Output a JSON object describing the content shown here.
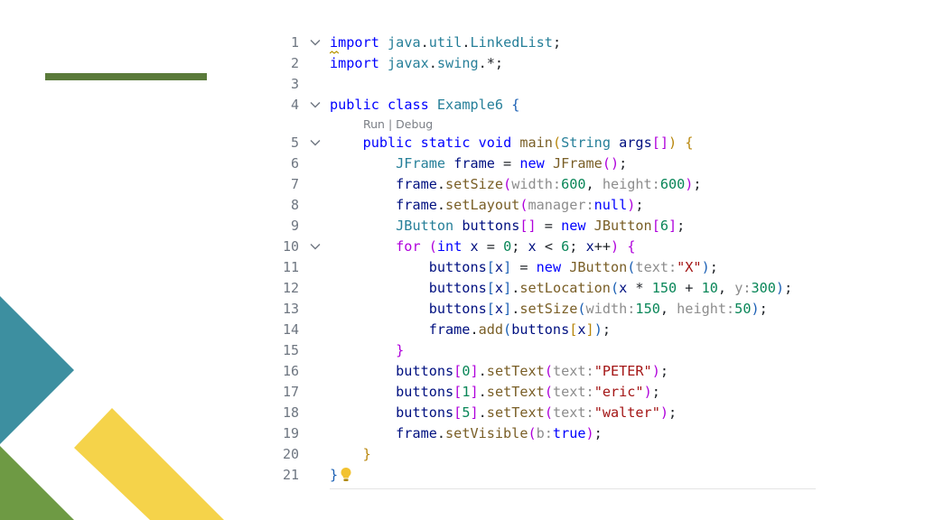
{
  "editor": {
    "codelens": "Run | Debug",
    "lines": [
      {
        "n": "1",
        "fold": true,
        "tokens": [
          [
            "kw",
            "import"
          ],
          [
            "punc",
            " "
          ],
          [
            "ty",
            "java"
          ],
          [
            "punc",
            "."
          ],
          [
            "ty",
            "util"
          ],
          [
            "punc",
            "."
          ],
          [
            "ty",
            "LinkedList"
          ],
          [
            "punc",
            ";"
          ]
        ]
      },
      {
        "n": "2",
        "fold": false,
        "tokens": [
          [
            "kw",
            "import"
          ],
          [
            "punc",
            " "
          ],
          [
            "ty",
            "javax"
          ],
          [
            "punc",
            "."
          ],
          [
            "ty",
            "swing"
          ],
          [
            "punc",
            ".*;"
          ]
        ]
      },
      {
        "n": "3",
        "fold": false,
        "tokens": []
      },
      {
        "n": "4",
        "fold": true,
        "lens_after": true,
        "tokens": [
          [
            "kw",
            "public"
          ],
          [
            "punc",
            " "
          ],
          [
            "kw",
            "class"
          ],
          [
            "punc",
            " "
          ],
          [
            "ty",
            "Example6"
          ],
          [
            "punc",
            " "
          ],
          [
            "br3",
            "{"
          ]
        ]
      },
      {
        "n": "5",
        "fold": true,
        "tokens": [
          [
            "punc",
            "    "
          ],
          [
            "kw",
            "public"
          ],
          [
            "punc",
            " "
          ],
          [
            "kw",
            "static"
          ],
          [
            "punc",
            " "
          ],
          [
            "kw",
            "void"
          ],
          [
            "punc",
            " "
          ],
          [
            "fn",
            "main"
          ],
          [
            "br1",
            "("
          ],
          [
            "ty",
            "String"
          ],
          [
            "punc",
            " "
          ],
          [
            "var",
            "args"
          ],
          [
            "br2",
            "[]"
          ],
          [
            "br1",
            ")"
          ],
          [
            "punc",
            " "
          ],
          [
            "br1",
            "{"
          ]
        ]
      },
      {
        "n": "6",
        "fold": false,
        "tokens": [
          [
            "punc",
            "        "
          ],
          [
            "ty",
            "JFrame"
          ],
          [
            "punc",
            " "
          ],
          [
            "var",
            "frame"
          ],
          [
            "punc",
            " = "
          ],
          [
            "kw",
            "new"
          ],
          [
            "punc",
            " "
          ],
          [
            "fn",
            "JFrame"
          ],
          [
            "br2",
            "()"
          ],
          [
            "punc",
            ";"
          ]
        ]
      },
      {
        "n": "7",
        "fold": false,
        "tokens": [
          [
            "punc",
            "        "
          ],
          [
            "var",
            "frame"
          ],
          [
            "punc",
            "."
          ],
          [
            "fn",
            "setSize"
          ],
          [
            "br2",
            "("
          ],
          [
            "hint",
            "width:"
          ],
          [
            "num",
            "600"
          ],
          [
            "punc",
            ", "
          ],
          [
            "hint",
            "height:"
          ],
          [
            "num",
            "600"
          ],
          [
            "br2",
            ")"
          ],
          [
            "punc",
            ";"
          ]
        ]
      },
      {
        "n": "8",
        "fold": false,
        "tokens": [
          [
            "punc",
            "        "
          ],
          [
            "var",
            "frame"
          ],
          [
            "punc",
            "."
          ],
          [
            "fn",
            "setLayout"
          ],
          [
            "br2",
            "("
          ],
          [
            "hint",
            "manager:"
          ],
          [
            "kw",
            "null"
          ],
          [
            "br2",
            ")"
          ],
          [
            "punc",
            ";"
          ]
        ]
      },
      {
        "n": "9",
        "fold": false,
        "tokens": [
          [
            "punc",
            "        "
          ],
          [
            "ty",
            "JButton"
          ],
          [
            "punc",
            " "
          ],
          [
            "var",
            "buttons"
          ],
          [
            "br2",
            "[]"
          ],
          [
            "punc",
            " = "
          ],
          [
            "kw",
            "new"
          ],
          [
            "punc",
            " "
          ],
          [
            "fn",
            "JButton"
          ],
          [
            "br2",
            "["
          ],
          [
            "num",
            "6"
          ],
          [
            "br2",
            "]"
          ],
          [
            "punc",
            ";"
          ]
        ]
      },
      {
        "n": "10",
        "fold": true,
        "tokens": [
          [
            "punc",
            "        "
          ],
          [
            "ctl",
            "for"
          ],
          [
            "punc",
            " "
          ],
          [
            "br2",
            "("
          ],
          [
            "kw",
            "int"
          ],
          [
            "punc",
            " "
          ],
          [
            "var",
            "x"
          ],
          [
            "punc",
            " = "
          ],
          [
            "num",
            "0"
          ],
          [
            "punc",
            "; "
          ],
          [
            "var",
            "x"
          ],
          [
            "punc",
            " < "
          ],
          [
            "num",
            "6"
          ],
          [
            "punc",
            "; "
          ],
          [
            "var",
            "x"
          ],
          [
            "punc",
            "++"
          ],
          [
            "br2",
            ")"
          ],
          [
            "punc",
            " "
          ],
          [
            "br2",
            "{"
          ]
        ]
      },
      {
        "n": "11",
        "fold": false,
        "tokens": [
          [
            "punc",
            "            "
          ],
          [
            "var",
            "buttons"
          ],
          [
            "br3",
            "["
          ],
          [
            "var",
            "x"
          ],
          [
            "br3",
            "]"
          ],
          [
            "punc",
            " = "
          ],
          [
            "kw",
            "new"
          ],
          [
            "punc",
            " "
          ],
          [
            "fn",
            "JButton"
          ],
          [
            "br3",
            "("
          ],
          [
            "hint",
            "text:"
          ],
          [
            "str",
            "\"X\""
          ],
          [
            "br3",
            ")"
          ],
          [
            "punc",
            ";"
          ]
        ]
      },
      {
        "n": "12",
        "fold": false,
        "tokens": [
          [
            "punc",
            "            "
          ],
          [
            "var",
            "buttons"
          ],
          [
            "br3",
            "["
          ],
          [
            "var",
            "x"
          ],
          [
            "br3",
            "]"
          ],
          [
            "punc",
            "."
          ],
          [
            "fn",
            "setLocation"
          ],
          [
            "br3",
            "("
          ],
          [
            "var",
            "x"
          ],
          [
            "punc",
            " * "
          ],
          [
            "num",
            "150"
          ],
          [
            "punc",
            " + "
          ],
          [
            "num",
            "10"
          ],
          [
            "punc",
            ", "
          ],
          [
            "hint",
            "y:"
          ],
          [
            "num",
            "300"
          ],
          [
            "br3",
            ")"
          ],
          [
            "punc",
            ";"
          ]
        ]
      },
      {
        "n": "13",
        "fold": false,
        "tokens": [
          [
            "punc",
            "            "
          ],
          [
            "var",
            "buttons"
          ],
          [
            "br3",
            "["
          ],
          [
            "var",
            "x"
          ],
          [
            "br3",
            "]"
          ],
          [
            "punc",
            "."
          ],
          [
            "fn",
            "setSize"
          ],
          [
            "br3",
            "("
          ],
          [
            "hint",
            "width:"
          ],
          [
            "num",
            "150"
          ],
          [
            "punc",
            ", "
          ],
          [
            "hint",
            "height:"
          ],
          [
            "num",
            "50"
          ],
          [
            "br3",
            ")"
          ],
          [
            "punc",
            ";"
          ]
        ]
      },
      {
        "n": "14",
        "fold": false,
        "tokens": [
          [
            "punc",
            "            "
          ],
          [
            "var",
            "frame"
          ],
          [
            "punc",
            "."
          ],
          [
            "fn",
            "add"
          ],
          [
            "br3",
            "("
          ],
          [
            "var",
            "buttons"
          ],
          [
            "br1",
            "["
          ],
          [
            "var",
            "x"
          ],
          [
            "br1",
            "]"
          ],
          [
            "br3",
            ")"
          ],
          [
            "punc",
            ";"
          ]
        ]
      },
      {
        "n": "15",
        "fold": false,
        "tokens": [
          [
            "punc",
            "        "
          ],
          [
            "br2",
            "}"
          ]
        ]
      },
      {
        "n": "16",
        "fold": false,
        "tokens": [
          [
            "punc",
            "        "
          ],
          [
            "var",
            "buttons"
          ],
          [
            "br2",
            "["
          ],
          [
            "num",
            "0"
          ],
          [
            "br2",
            "]"
          ],
          [
            "punc",
            "."
          ],
          [
            "fn",
            "setText"
          ],
          [
            "br2",
            "("
          ],
          [
            "hint",
            "text:"
          ],
          [
            "str",
            "\"PETER\""
          ],
          [
            "br2",
            ")"
          ],
          [
            "punc",
            ";"
          ]
        ]
      },
      {
        "n": "17",
        "fold": false,
        "tokens": [
          [
            "punc",
            "        "
          ],
          [
            "var",
            "buttons"
          ],
          [
            "br2",
            "["
          ],
          [
            "num",
            "1"
          ],
          [
            "br2",
            "]"
          ],
          [
            "punc",
            "."
          ],
          [
            "fn",
            "setText"
          ],
          [
            "br2",
            "("
          ],
          [
            "hint",
            "text:"
          ],
          [
            "str",
            "\"eric\""
          ],
          [
            "br2",
            ")"
          ],
          [
            "punc",
            ";"
          ]
        ]
      },
      {
        "n": "18",
        "fold": false,
        "tokens": [
          [
            "punc",
            "        "
          ],
          [
            "var",
            "buttons"
          ],
          [
            "br2",
            "["
          ],
          [
            "num",
            "5"
          ],
          [
            "br2",
            "]"
          ],
          [
            "punc",
            "."
          ],
          [
            "fn",
            "setText"
          ],
          [
            "br2",
            "("
          ],
          [
            "hint",
            "text:"
          ],
          [
            "str",
            "\"walter\""
          ],
          [
            "br2",
            ")"
          ],
          [
            "punc",
            ";"
          ]
        ]
      },
      {
        "n": "19",
        "fold": false,
        "tokens": [
          [
            "punc",
            "        "
          ],
          [
            "var",
            "frame"
          ],
          [
            "punc",
            "."
          ],
          [
            "fn",
            "setVisible"
          ],
          [
            "br2",
            "("
          ],
          [
            "hint",
            "b:"
          ],
          [
            "kw",
            "true"
          ],
          [
            "br2",
            ")"
          ],
          [
            "punc",
            ";"
          ]
        ]
      },
      {
        "n": "20",
        "fold": false,
        "tokens": [
          [
            "punc",
            "    "
          ],
          [
            "br1",
            "}"
          ]
        ]
      },
      {
        "n": "21",
        "fold": false,
        "bulb": true,
        "tokens": [
          [
            "br3",
            "}"
          ]
        ]
      }
    ]
  },
  "colors": {
    "accent_bar": "#5a7a3a",
    "teal": "#3d8fa0",
    "green": "#6e9a44",
    "yellow": "#f5d34a",
    "bulb": "#f2c230"
  }
}
